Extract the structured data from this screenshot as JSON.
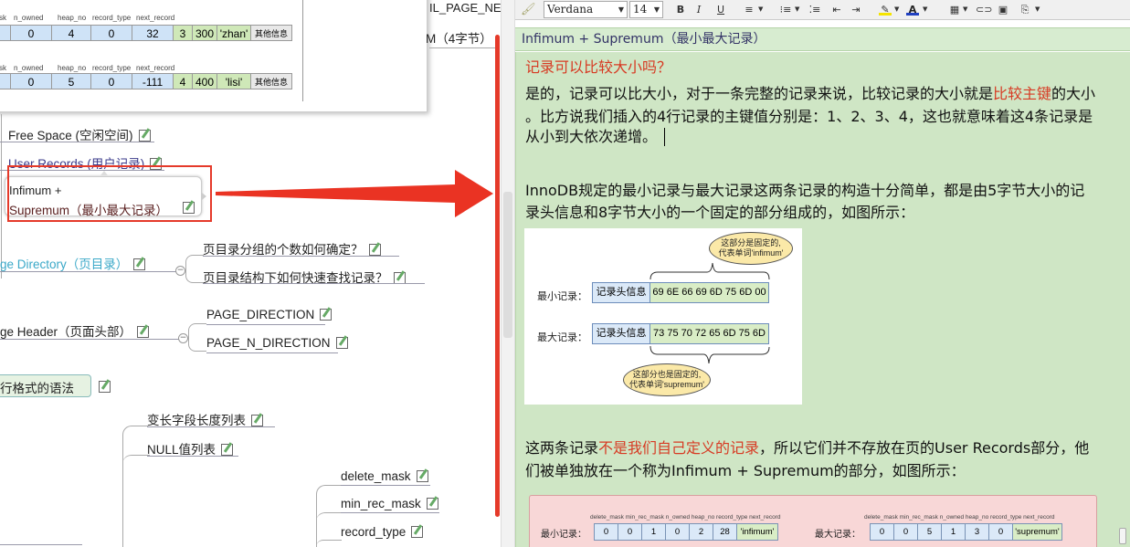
{
  "popup": {
    "headers": [
      "sk",
      "n_owned",
      "heap_no",
      "record_type",
      "next_record"
    ],
    "row1": [
      "0",
      "4",
      "0",
      "32",
      "3",
      "300",
      "'zhan'",
      "其他信息"
    ],
    "row2": [
      "0",
      "5",
      "0",
      "-111",
      "4",
      "400",
      "'lisi'",
      "其他信息"
    ]
  },
  "mindmap": {
    "page_new": "IL_PAGE_NE",
    "m4": "M（4字节）",
    "free_space": "Free Space (空闲空间)",
    "user_records": "User Records (用户记录)",
    "infimum_l1": "Infimum +",
    "infimum_l2": "Supremum（最小最大记录）",
    "page_directory": "ge Directory（页目录）",
    "pd_child1": "页目录分组的个数如何确定？",
    "pd_child2": "页目录结构下如何快速查找记录？",
    "page_header": "ge Header（页面头部）",
    "ph_child1": "PAGE_DIRECTION",
    "ph_child2": "PAGE_N_DIRECTION",
    "row_format": "行格式的语法",
    "var_len": "变长字段长度列表",
    "null_list": "NULL值列表",
    "delete_mask": "delete_mask",
    "min_rec_mask": "min_rec_mask",
    "record_type": "record_type"
  },
  "toolbar": {
    "font": "Verdana",
    "size": "14",
    "bold": "B",
    "italic": "I",
    "underline": "U"
  },
  "note": {
    "title": "Infimum + Supremum（最小最大记录）",
    "q": "记录可以比较大小吗？",
    "p1a": "是的，记录可以比大小，对于一条完整的记录来说，比较记录的大小就是",
    "p1red": "比较主键",
    "p1b": "的大小",
    "p1c": "。比方说我们插入的4行记录的主键值分别是：1、2、3、4，这也就意味着这4条记录是",
    "p1d": "从小到大依次递增。",
    "p2a": "InnoDB规定的最小记录与最大记录这两条记录的构造十分简单，都是由5字节大小的记",
    "p2b": "录头信息和8字节大小的一个固定的部分组成的，如图所示：",
    "p3a": "这两条记录",
    "p3red": "不是我们自己定义的记录",
    "p3b": "，所以它们并不存放在页的User Records部分，他",
    "p3c": "们被单独放在一个称为Infimum + Supremum的部分，如图所示："
  },
  "figure1": {
    "bubble_top": "这部分是固定的,\n代表单词'infimum'",
    "min_label": "最小记录：",
    "max_label": "最大记录：",
    "header_cell": "记录头信息",
    "min_hex": "69 6E 66 69 6D 75 6D 00",
    "max_hex": "73 75 70 72 65 6D 75 6D",
    "bubble_bottom": "这部分也是固定的,\n代表单词'supremum'"
  },
  "figure2": {
    "headers": "delete_mask min_rec_mask n_owned heap_no record_type  next_record",
    "min_label": "最小记录：",
    "max_label": "最大记录：",
    "min_vals": [
      "0",
      "0",
      "1",
      "0",
      "2",
      "28",
      "'infimum'"
    ],
    "max_vals": [
      "0",
      "0",
      "5",
      "1",
      "3",
      "0",
      "'supremum'"
    ]
  }
}
